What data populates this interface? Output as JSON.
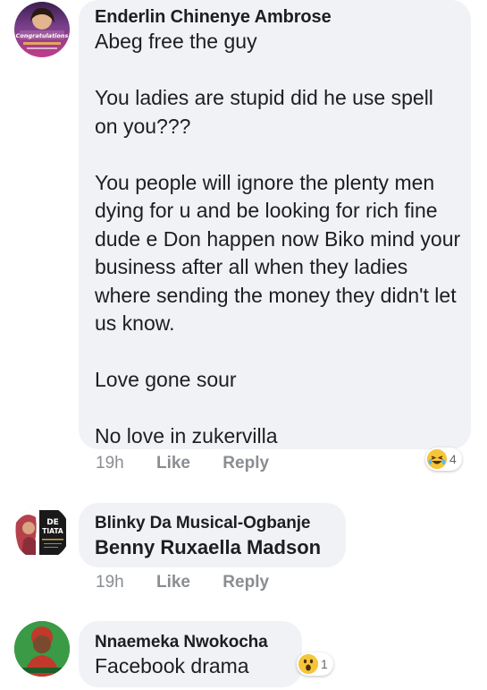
{
  "comments": [
    {
      "author": "Enderlin Chinenye Ambrose",
      "text": "Abeg free the guy\n\nYou ladies are stupid did he use spell on you???\n\nYou people will ignore the plenty men dying for u and be looking for rich fine dude e Don happen now Biko mind your business after all when they ladies where sending the money they didn't let us know.\n\nLove gone sour\n\nNo love in zukervilla",
      "time": "19h",
      "like_label": "Like",
      "reply_label": "Reply",
      "reaction": {
        "icon": "laughing-emoji-icon",
        "count": "4"
      },
      "avatar_text": "Congratulations"
    },
    {
      "author": "Blinky Da Musical-Ogbanje",
      "text": "Benny Ruxaella Madson",
      "time": "19h",
      "like_label": "Like",
      "reply_label": "Reply",
      "avatar_text_1": "DE",
      "avatar_text_2": "TIATA"
    },
    {
      "author": "Nnaemeka Nwokocha",
      "text": "Facebook drama",
      "reaction": {
        "icon": "wow-emoji-icon",
        "count": "1"
      }
    }
  ],
  "colors": {
    "bubble": "#f0f2f5",
    "meta_text": "#8a8d91",
    "emoji_yellow": "#f7c53a"
  }
}
